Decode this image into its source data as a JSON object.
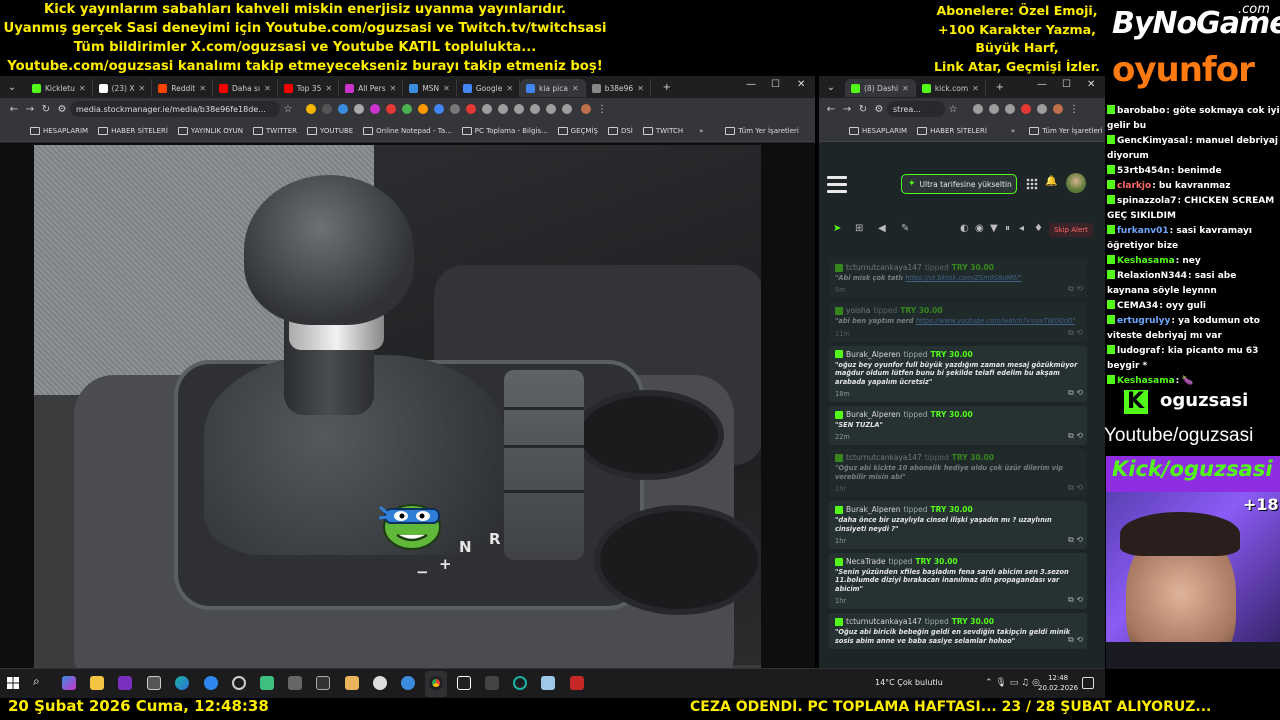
{
  "banner": {
    "lines": [
      "Kick yayınlarım sabahları kahveli miskin enerjisiz uyanma yayınlarıdır.",
      "Uyanmış gerçek Sasi deneyimi için Youtube.com/oguzsasi ve Twitch.tv/twitchsasi",
      "Tüm bildirimler X.com/oguzsasi ve Youtube KATIL toplulukta...",
      "Youtube.com/oguzsasi kanalımı takip etmeyecekseniz burayı takip etmeniz boş!"
    ],
    "subscribers": [
      "Abonelere: Özel Emoji,",
      "+100 Karakter Yazma,",
      "Büyük Harf,",
      "Link Atar, Geçmişi İzler."
    ]
  },
  "logo": {
    "main": "ByNoGame",
    "com": ".com",
    "sub": "oyunfor"
  },
  "left_browser": {
    "tabs": [
      {
        "label": "Kickletu",
        "color": "#53fc18"
      },
      {
        "label": "(23) X",
        "color": "#ffffff"
      },
      {
        "label": "Reddit",
        "color": "#ff4500"
      },
      {
        "label": "Daha sı",
        "color": "#ff0000"
      },
      {
        "label": "Top 35",
        "color": "#ff0000"
      },
      {
        "label": "All Pers",
        "color": "#cc33cc"
      },
      {
        "label": "MSN",
        "color": "#3a8dde"
      },
      {
        "label": "Google",
        "color": "#4285f4"
      },
      {
        "label": "kia pica",
        "color": "#4285f4"
      },
      {
        "label": "b38e96",
        "color": "#888888"
      }
    ],
    "url": "media.stockmanager.ie/media/b38e96fe18de...",
    "bookmarks": [
      "HESAPLARIM",
      "HABER SİTELERİ",
      "YAYINLIK OYUN",
      "TWITTER",
      "YOUTUBE",
      "Online Notepad - Ta...",
      "PC Toplama - Bilgis...",
      "GEÇMİŞ",
      "DSİ",
      "TWITCH"
    ],
    "all_bookmarks": "Tüm Yer İşaretleri",
    "photo_labels": {
      "r": "R",
      "n": "N",
      "plus": "+",
      "minus": "−"
    }
  },
  "right_browser": {
    "tabs": [
      {
        "label": "(8) Dashi",
        "color": "#53fc18"
      },
      {
        "label": "kick.com",
        "color": "#53fc18"
      }
    ],
    "url": "strea...",
    "bookmarks": [
      "HESAPLARIM",
      "HABER SİTELERİ"
    ],
    "all_bookmarks": "Tüm Yer İşaretleri",
    "upgrade_label": "Ultra tarifesine yükseltin",
    "skip_label": "Skip Alert",
    "alerts": [
      {
        "user": "tcturnutcankaya147",
        "tipped": "tipped",
        "amount": "TRY 30.00",
        "msg": "\"Abi misk çok tatlı",
        "link": "https://vt.tiktok.com/ZSm9S8uM0/\"",
        "time": "9m",
        "faded": true
      },
      {
        "user": "yoisha",
        "tipped": "tipped",
        "amount": "TRY 30.00",
        "msg": "\"abi ben yaptım nerd",
        "link": "https://www.youtube.com/watch?v=oxTWO0rj0\"",
        "time": "11m",
        "faded": true
      },
      {
        "user": "Burak_Alperen",
        "tipped": "tipped",
        "amount": "TRY 30.00",
        "msg": "\"oğuz bey oyunfor full büyük yazdığım zaman mesaj gözükmüyor mağdur oldum lütfen bunu bi şekilde telafi edelim bu akşam arabada yapalım ücretsiz\"",
        "link": "",
        "time": "18m",
        "faded": false
      },
      {
        "user": "Burak_Alperen",
        "tipped": "tipped",
        "amount": "TRY 30.00",
        "msg": "\"SEN TUZLA\"",
        "link": "",
        "time": "22m",
        "faded": false
      },
      {
        "user": "tcturnutcankaya147",
        "tipped": "tipped",
        "amount": "TRY 30.00",
        "msg": "\"Oğuz abi kickte 10 abonelik hediye oldu çok üzür dilerim vip verebilir misin abi\"",
        "link": "",
        "time": "1hr",
        "faded": true
      },
      {
        "user": "Burak_Alperen",
        "tipped": "tipped",
        "amount": "TRY 30.00",
        "msg": "\"daha önce bir uzaylıyla cinsel ilişki yaşadın mı ? uzaylının cinsiyeti neydi ?\"",
        "link": "",
        "time": "1hr",
        "faded": false
      },
      {
        "user": "NecaTrade",
        "tipped": "tipped",
        "amount": "TRY 30.00",
        "msg": "\"Senin yüzünden xfiles başladım fena sardı abicim sen 3.sezon 11.bolumde diziyi bırakacan inanılmaz din propagandası var abicim\"",
        "link": "",
        "time": "1hr",
        "faded": false
      },
      {
        "user": "tcturnutcankaya147",
        "tipped": "tipped",
        "amount": "TRY 30.00",
        "msg": "\"Oğuz abi biricik bebeğin geldi en sevdiğin takipçin geldi minik sosis abim anne ve baba sasiye selamlar hohoo\"",
        "link": "",
        "time": "",
        "faded": false
      }
    ]
  },
  "chat": [
    {
      "user": "barobabo",
      "color": "#ffffff",
      "text": ": göte sokmaya cok iyi gelir bu"
    },
    {
      "user": "GencKimyasal",
      "color": "#ffffff",
      "text": ": manuel debriyaj diyorum"
    },
    {
      "user": "53rtb454n",
      "color": "#ffffff",
      "text": ": benimde"
    },
    {
      "user": "clarkjo",
      "color": "#ff6b6b",
      "text": ": bu kavranmaz"
    },
    {
      "user": "spinazzola7",
      "color": "#ffffff",
      "text": ": CHICKEN SCREAM GEÇ SIKILDIM"
    },
    {
      "user": "furkanv01",
      "color": "#6fa8ff",
      "text": ": sasi kavramayı öğretiyor bize"
    },
    {
      "user": "Keshasama",
      "color": "#53fc18",
      "text": ": ney"
    },
    {
      "user": "RelaxionN344",
      "color": "#ffffff",
      "text": ": sasi abe kaynana söyle leynnn"
    },
    {
      "user": "CEMA34",
      "color": "#ffffff",
      "text": ": oyy guli"
    },
    {
      "user": "ertugrulyy",
      "color": "#6fa8ff",
      "text": ": ya kodumun oto viteste debriyaj mı var"
    },
    {
      "user": "ludograf",
      "color": "#ffffff",
      "text": ": kia picanto mu 63 beygir *"
    },
    {
      "user": "Keshasama",
      "color": "#53fc18",
      "text": ": 🍆"
    }
  ],
  "socials": {
    "kick_handle": "oguzsasi",
    "youtube": "Youtube/oguzsasi",
    "kick_url": "Kick/oguzsasi",
    "age": "+18"
  },
  "taskbar": {
    "weather": "14°C  Çok bulutlu",
    "time": "12:48",
    "date": "20.02.2026"
  },
  "ticker": {
    "datetime": "20 Şubat 2026 Cuma, 12:48:38",
    "news": "CEZA ÖDENDİ. PC TOPLAMA HAFTASI... 23 / 28 ŞUBAT ALIYORUZ..."
  },
  "colors": {
    "accent_yellow": "#ffee00",
    "kick_green": "#53fc18",
    "band_purple": "#8e2de2"
  }
}
